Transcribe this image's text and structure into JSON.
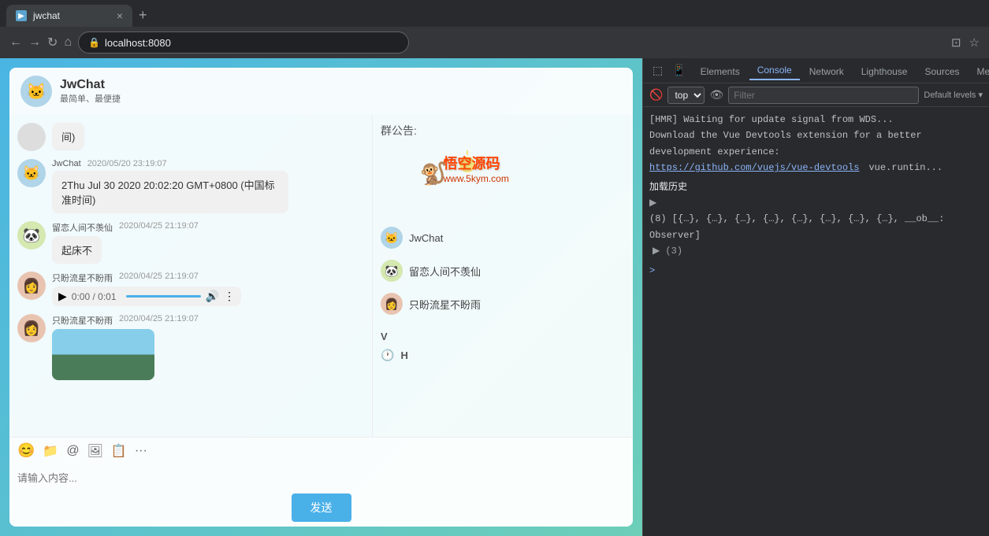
{
  "browser": {
    "tab_title": "jwchat",
    "tab_close": "×",
    "tab_new": "+",
    "nav_back": "←",
    "nav_forward": "→",
    "nav_refresh": "↻",
    "nav_home": "⌂",
    "url": "localhost:8080",
    "nav_cast": "⊡",
    "nav_bookmark": "☆"
  },
  "chat": {
    "header_title": "JwChat",
    "header_subtitle": "最简单、最便捷",
    "header_avatar": "🐱",
    "messages": [
      {
        "sender": "",
        "time": "",
        "text": "间)",
        "type": "bubble",
        "avatar": ""
      },
      {
        "sender": "JwChat",
        "time": "2020/05/20 23:19:07",
        "text": "2Thu Jul 30 2020 20:02:20 GMT+0800 (中国标准时间)",
        "type": "bubble",
        "avatar": "🐱"
      },
      {
        "sender": "留恋人间不羡仙",
        "time": "2020/04/25 21:19:07",
        "text": "起床不",
        "type": "bubble",
        "avatar": "🐼"
      },
      {
        "sender": "只盼流星不盼雨",
        "time": "2020/04/25 21:19:07",
        "text": "",
        "type": "audio",
        "avatar": "👩"
      },
      {
        "sender": "只盼流星不盼雨",
        "time": "2020/04/25 21:19:07",
        "text": "",
        "type": "image",
        "avatar": "👩"
      }
    ],
    "toolbar": {
      "emoji": "😊",
      "folder": "📁",
      "at": "🔗",
      "image": "🖼",
      "clip": "📋",
      "more": "···"
    },
    "input_placeholder": "请输入内容...",
    "send_button": "发送",
    "right_panel": {
      "notice_label": "群公告:",
      "members": [
        {
          "name": "JwChat",
          "avatar": "🐱"
        },
        {
          "name": "留恋人间不羡仙",
          "avatar": "🐼"
        },
        {
          "name": "只盼流星不盼雨",
          "avatar": "👩"
        }
      ],
      "sidebar_v": "V",
      "sidebar_h": "H",
      "watermark_line1": "悟空源码",
      "watermark_line2": "www.5kym.com"
    }
  },
  "devtools": {
    "tabs": [
      {
        "label": "Elements",
        "active": false
      },
      {
        "label": "Console",
        "active": true
      },
      {
        "label": "Network",
        "active": false
      },
      {
        "label": "Lighthouse",
        "active": false
      },
      {
        "label": "Sources",
        "active": false
      },
      {
        "label": "Memory",
        "active": false
      }
    ],
    "toolbar": {
      "top_label": "top",
      "filter_placeholder": "Filter",
      "levels_label": "Default levels ▾"
    },
    "console_lines": [
      "[HMR] Waiting for update signal from WDS...",
      "Download the Vue Devtools extension for a better",
      "development experience:",
      "https://github.com/vuejs/vue-devtools",
      "加载历史",
      "▶ (8) [{…}, {…}, {…}, {…}, {…}, {…}, {…}, {…}, __ob__: Observer] ▶ (3)",
      ">"
    ]
  }
}
